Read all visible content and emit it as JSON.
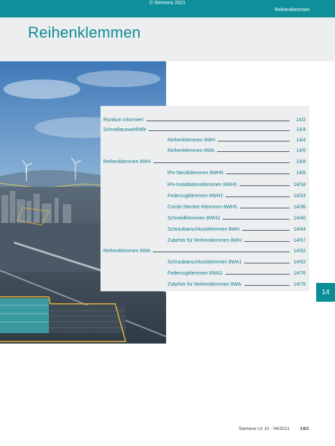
{
  "header": {
    "copyright": "© Siemens 2021",
    "section": "Reihenklemmen"
  },
  "page": {
    "title": "Reihenklemmen",
    "chapter_tab": "14"
  },
  "toc": [
    {
      "label": "Rundum informiert",
      "page": "14/2",
      "level": 1
    },
    {
      "label": "Schnellauswahlhilfe",
      "page": "14/4",
      "level": 1
    },
    {
      "label": "Reihenklemmen 8WH",
      "page": "14/4",
      "level": 2
    },
    {
      "label": "Reihenklemmen 8WA",
      "page": "14/6",
      "level": 2
    },
    {
      "label": "Reihenklemmen 8WH",
      "page": "14/8",
      "level": 1
    },
    {
      "label": "iPo-Steckklemmen 8WH6",
      "page": "14/8",
      "level": 2
    },
    {
      "label": "iPo-Installationsklemmen 8WH6",
      "page": "14/18",
      "level": 2
    },
    {
      "label": "Federzugklemmen 8WH2",
      "page": "14/24",
      "level": 2
    },
    {
      "label": "Combi-Stecker-Klemmen 8WH5",
      "page": "14/36",
      "level": 2
    },
    {
      "label": "Schneidklemmen 8WH3",
      "page": "14/40",
      "level": 2
    },
    {
      "label": "Schraubanschlussklemmen 8WH",
      "page": "14/44",
      "level": 2
    },
    {
      "label": "Zubehör für Reihenklemmen 8WH",
      "page": "14/57",
      "level": 2
    },
    {
      "label": "Reihenklemmen 8WA",
      "page": "14/62",
      "level": 1
    },
    {
      "label": "Schraubanschlussklemmen 8WA1",
      "page": "14/62",
      "level": 2
    },
    {
      "label": "Federzugklemmen 8WA2",
      "page": "14/76",
      "level": 2
    },
    {
      "label": "Zubehör für Reihenklemmen 8WA",
      "page": "14/78",
      "level": 2
    }
  ],
  "footer": {
    "publication": "Siemens LV 10 · 04/2021",
    "page_number": "14/1"
  },
  "colors": {
    "accent": "#0e8f9a",
    "panel": "#eceef0"
  }
}
